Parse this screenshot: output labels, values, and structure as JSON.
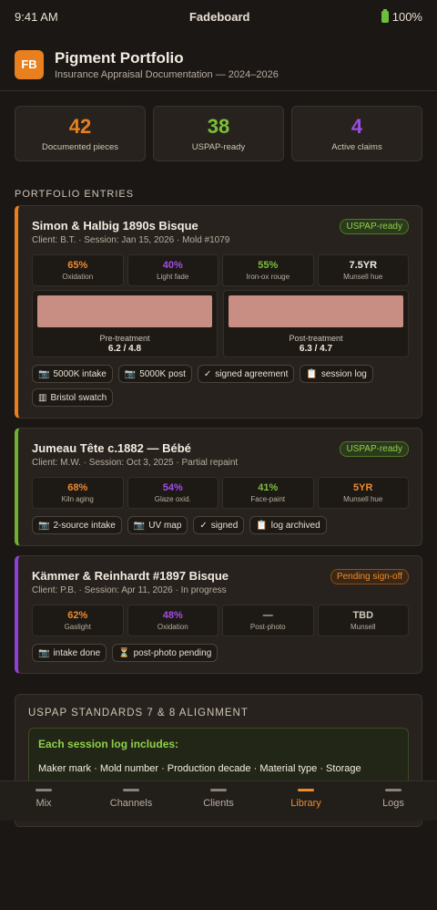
{
  "status": {
    "time": "9:41 AM",
    "app": "Fadeboard",
    "battery": "100%"
  },
  "header": {
    "logo": "FB",
    "title": "Pigment Portfolio",
    "subtitle": "Insurance Appraisal Documentation — 2024–2026"
  },
  "stats": [
    {
      "value": "42",
      "label": "Documented pieces",
      "color": "#e8801f"
    },
    {
      "value": "38",
      "label": "USPAP-ready",
      "color": "#7bbf3a"
    },
    {
      "value": "4",
      "label": "Active claims",
      "color": "#9b4de0"
    }
  ],
  "section": {
    "title": "PORTFOLIO ENTRIES"
  },
  "entries": [
    {
      "title": "Simon & Halbig 1890s Bisque",
      "meta": "Client: B.T. · Session: Jan 15, 2026 · Mold #1079",
      "badge": "USPAP-ready",
      "accent": "#e8801f",
      "metrics": [
        {
          "value": "65%",
          "label": "Oxidation",
          "color": "#ee8a2c"
        },
        {
          "value": "40%",
          "label": "Light fade",
          "color": "#a34de6"
        },
        {
          "value": "55%",
          "label": "Iron-ox rouge",
          "color": "#7bbf3a"
        },
        {
          "value": "7.5YR",
          "label": "Munsell hue",
          "color": "#f3ece2"
        }
      ],
      "swatches": [
        {
          "caption": "Pre-treatment",
          "value": "6.2 / 4.8"
        },
        {
          "caption": "Post-treatment",
          "value": "6.3 / 4.7"
        }
      ],
      "chips": [
        {
          "icon": "📷",
          "label": "5000K intake"
        },
        {
          "icon": "📷",
          "label": "5000K post"
        },
        {
          "icon": "✓",
          "label": "signed agreement"
        },
        {
          "icon": "📋",
          "label": "session log"
        },
        {
          "icon": "▥",
          "label": "Bristol swatch"
        }
      ]
    },
    {
      "title": "Jumeau Tête c.1882 — Bébé",
      "meta": "Client: M.W. · Session: Oct 3, 2025 · Partial repaint",
      "badge": "USPAP-ready",
      "accent": "#6cb22e",
      "metrics": [
        {
          "value": "68%",
          "label": "Kiln aging",
          "color": "#ee8a2c"
        },
        {
          "value": "54%",
          "label": "Glaze oxid.",
          "color": "#a34de6"
        },
        {
          "value": "41%",
          "label": "Face-paint",
          "color": "#7bbf3a"
        },
        {
          "value": "5YR",
          "label": "Munsell hue",
          "color": "#ee8a2c"
        }
      ],
      "chips": [
        {
          "icon": "📷",
          "label": "2-source intake"
        },
        {
          "icon": "📷",
          "label": "UV map"
        },
        {
          "icon": "✓",
          "label": "signed"
        },
        {
          "icon": "📋",
          "label": "log archived"
        }
      ]
    },
    {
      "title": "Kämmer & Reinhardt #1897 Bisque",
      "meta": "Client: P.B. · Session: Apr 11, 2026 · In progress",
      "badge": "Pending sign-off",
      "accent": "#8e3fd6",
      "metrics": [
        {
          "value": "62%",
          "label": "Gaslight",
          "color": "#ee8a2c"
        },
        {
          "value": "48%",
          "label": "Oxidation",
          "color": "#a34de6"
        },
        {
          "value": "—",
          "label": "Post-photo",
          "color": "#cfc5b7"
        },
        {
          "value": "TBD",
          "label": "Munsell",
          "color": "#cfc5b7"
        }
      ],
      "chips": [
        {
          "icon": "📷",
          "label": "intake done"
        },
        {
          "icon": "⏳",
          "label": "post-photo pending"
        }
      ]
    }
  ],
  "standards": {
    "title": "USPAP STANDARDS 7 & 8 ALIGNMENT",
    "box_head": "Each session log includes:",
    "box_body": "Maker mark · Mold number · Production decade · Material type · Storage"
  },
  "tabs": [
    {
      "label": "Mix",
      "active": false
    },
    {
      "label": "Channels",
      "active": false
    },
    {
      "label": "Clients",
      "active": false
    },
    {
      "label": "Library",
      "active": true
    },
    {
      "label": "Logs",
      "active": false
    }
  ]
}
